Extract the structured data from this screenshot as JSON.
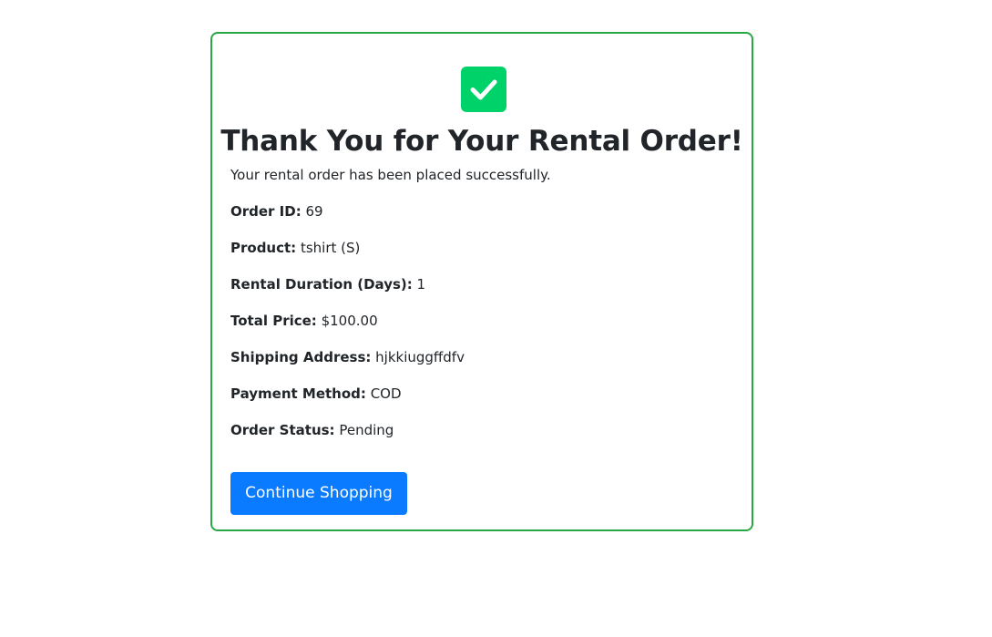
{
  "confirmation": {
    "icon": "check-mark-icon",
    "icon_color": "#00d26a",
    "border_color": "#28a745",
    "title": "Thank You for Your Rental Order!",
    "message": "Your rental order has been placed successfully."
  },
  "order": {
    "id_label": "Order ID:",
    "id_value": "69",
    "product_label": "Product:",
    "product_value": "tshirt (S)",
    "duration_label": "Rental Duration (Days):",
    "duration_value": "1",
    "price_label": "Total Price:",
    "price_value": "$100.00",
    "address_label": "Shipping Address:",
    "address_value": "hjkkiuggffdfv",
    "payment_label": "Payment Method:",
    "payment_value": "COD",
    "status_label": "Order Status:",
    "status_value": "Pending"
  },
  "actions": {
    "continue_label": "Continue Shopping",
    "button_color": "#0a7bff"
  }
}
